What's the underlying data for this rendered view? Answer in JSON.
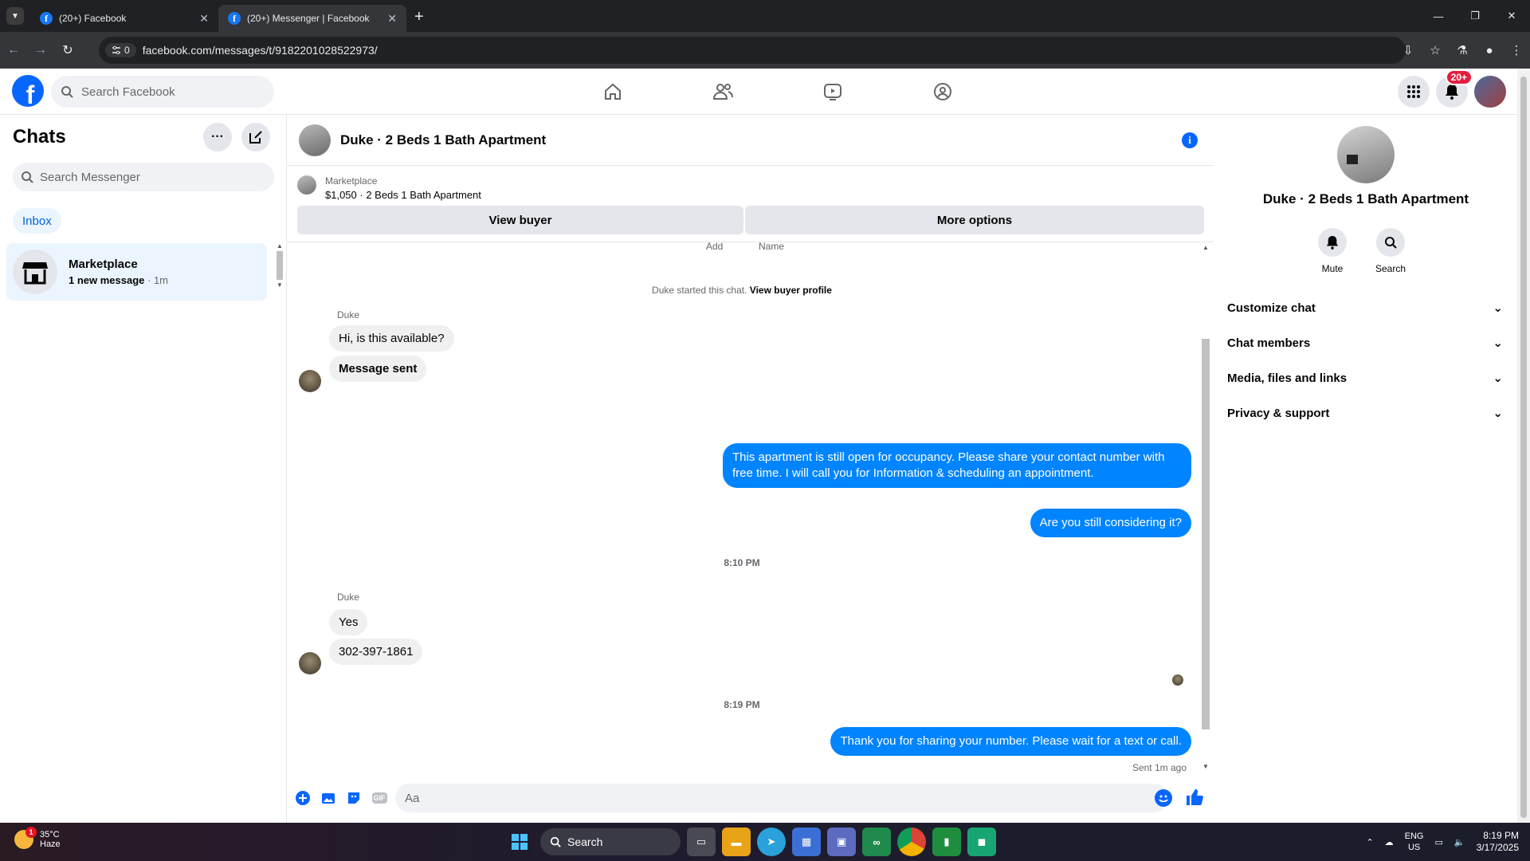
{
  "browser": {
    "tabs": [
      {
        "title": "(20+) Facebook",
        "active": false
      },
      {
        "title": "(20+) Messenger | Facebook",
        "active": true
      }
    ],
    "url": "facebook.com/messages/t/9182201028522973/",
    "site_info_count": "0"
  },
  "fb_header": {
    "search_placeholder": "Search Facebook",
    "notification_badge": "20+"
  },
  "sidebar": {
    "title": "Chats",
    "search_placeholder": "Search Messenger",
    "filter_pill": "Inbox",
    "conversations": [
      {
        "name": "Marketplace",
        "preview_bold": "1 new message",
        "time": " · 1m"
      }
    ]
  },
  "chat": {
    "title": "Duke · 2 Beds 1 Bath Apartment",
    "marketplace_label": "Marketplace",
    "listing": "$1,050 · 2 Beds 1 Bath Apartment",
    "view_buyer_button": "View buyer",
    "more_options_button": "More options",
    "truncated_labels": [
      "Add",
      "Name"
    ],
    "system_text": "Duke started this chat. ",
    "system_link": "View buyer profile",
    "messages": {
      "sender_1": "Duke",
      "in_1": "Hi, is this available?",
      "in_2": "Message sent",
      "out_1": "This apartment is still open for occupancy. Please share your contact number with free time. I will call you for Information & scheduling an appointment.",
      "out_2": "Are you still considering it?",
      "time_1": "8:10 PM",
      "sender_2": "Duke",
      "in_3": "Yes",
      "in_4": "302-397-1861",
      "time_2": "8:19 PM",
      "out_3": "Thank you for sharing your number. Please wait for a text or call.",
      "status": "Sent 1m ago"
    },
    "composer_placeholder": "Aa",
    "gif_label": "GIF"
  },
  "details_panel": {
    "name": "Duke · 2 Beds 1 Bath Apartment",
    "actions": [
      "Mute",
      "Search"
    ],
    "sections": [
      "Customize chat",
      "Chat members",
      "Media, files and links",
      "Privacy & support"
    ]
  },
  "taskbar": {
    "weather_temp": "35°C",
    "weather_desc": "Haze",
    "weather_badge": "1",
    "search_label": "Search",
    "lang_1": "ENG",
    "lang_2": "US",
    "time": "8:19 PM",
    "date": "3/17/2025"
  },
  "colors": {
    "brand_blue": "#0866ff",
    "outgoing_bubble": "#0084ff",
    "incoming_bubble": "#f0f0f0",
    "badge_red": "#e41e3f"
  }
}
